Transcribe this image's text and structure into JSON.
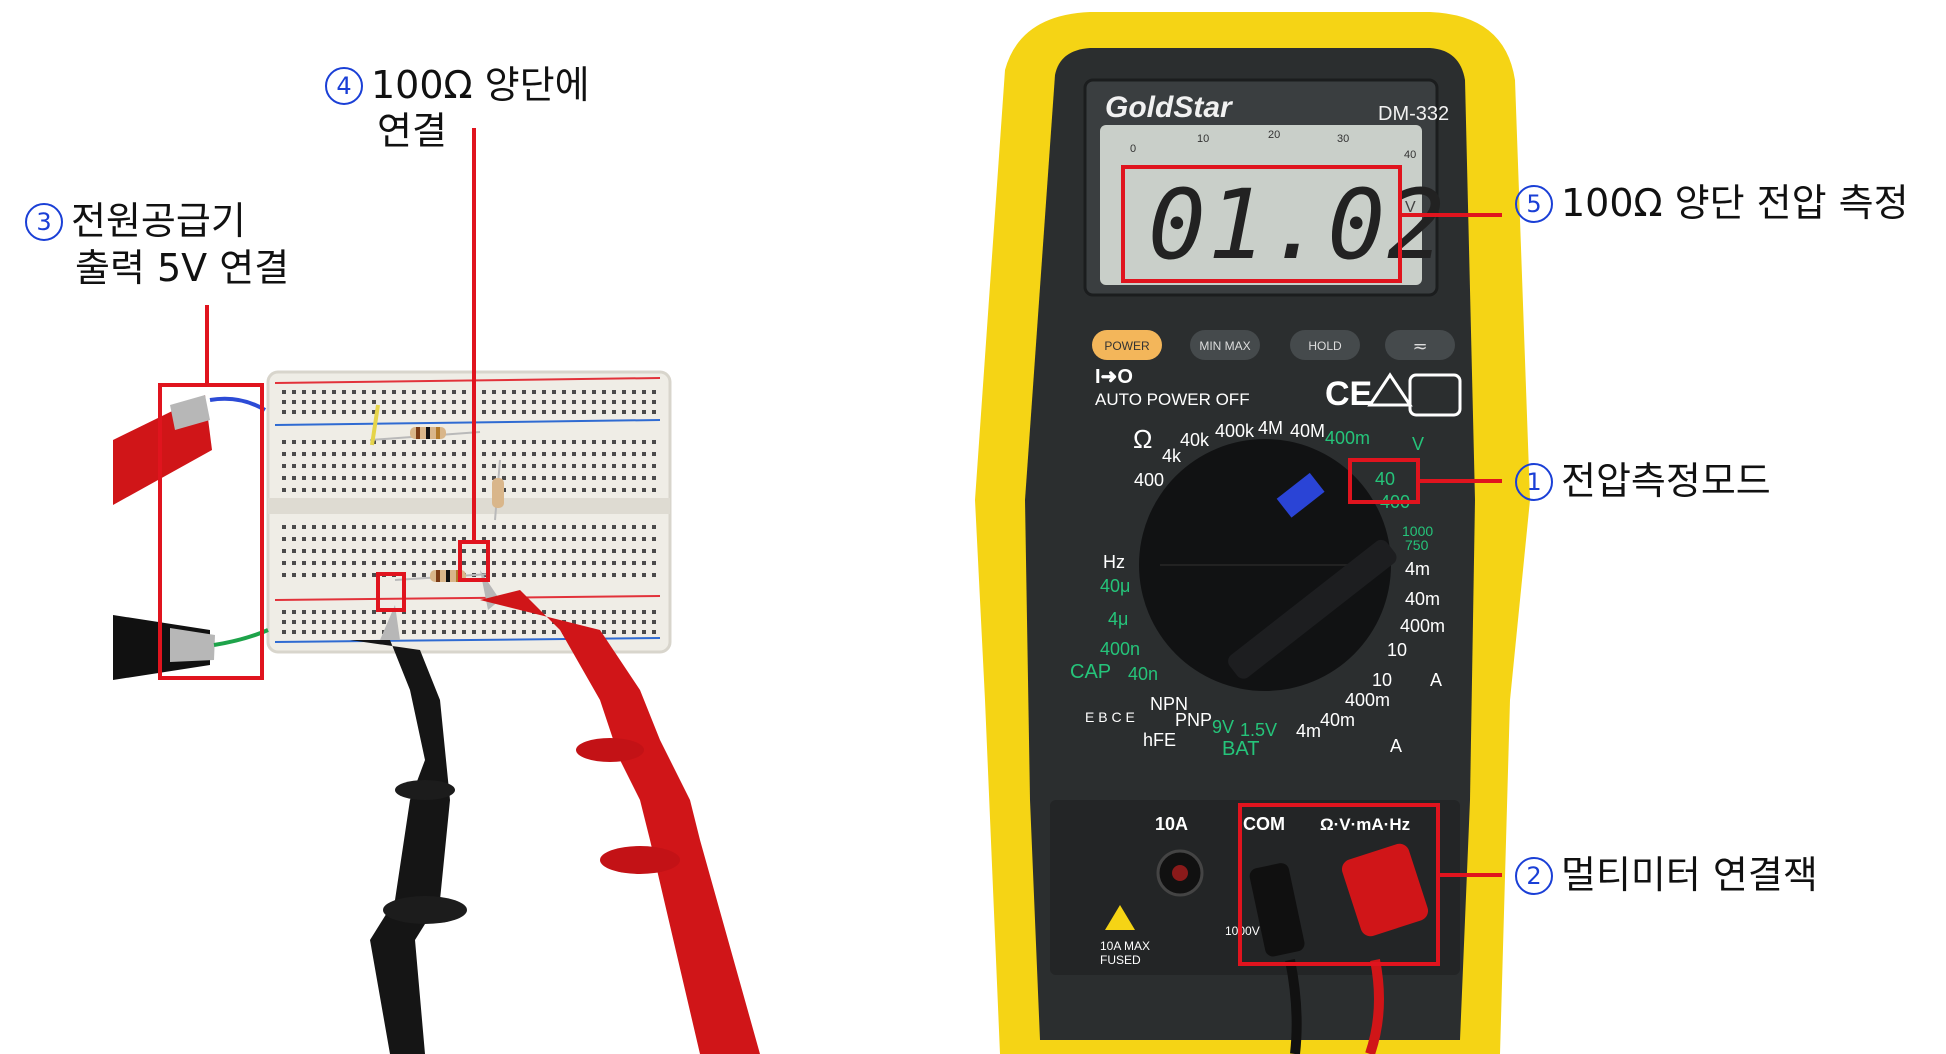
{
  "callouts": {
    "c1": {
      "num": "1",
      "text": "전압측정모드"
    },
    "c2": {
      "num": "2",
      "text": "멀티미터 연결잭"
    },
    "c3": {
      "num": "3",
      "line1": "전원공급기",
      "line2": "출력 5V 연결"
    },
    "c4": {
      "num": "4",
      "line1": "100Ω 양단에",
      "line2": "연결"
    },
    "c5": {
      "num": "5",
      "text": "100Ω 양단 전압 측정"
    }
  },
  "meter": {
    "brand": "GoldStar",
    "model": "DM-332",
    "reading": "01.02",
    "scale_marks": [
      "0",
      "10",
      "20",
      "30",
      "40"
    ],
    "buttons": {
      "power": "POWER",
      "minmax": "MIN MAX",
      "hold": "HOLD",
      "acdc": "≂"
    },
    "auto_power_off": "AUTO POWER OFF",
    "auto_power_icon": "I➜O",
    "ce_mark": "CE",
    "dial": {
      "ohm_symbol": "Ω",
      "ohm_ranges": [
        "400",
        "4k",
        "40k",
        "400k",
        "4M",
        "40M",
        "400m"
      ],
      "dc_volt_ranges": [
        "40",
        "400",
        "1000"
      ],
      "ac_volt_range": "750",
      "dc_amp_ranges": [
        "4m",
        "40m",
        "400m",
        "10"
      ],
      "ac_amp_ranges": [
        "10",
        "400m",
        "40m",
        "4m"
      ],
      "hz_label": "Hz",
      "cap_ranges": [
        "40μ",
        "4μ",
        "400n",
        "40n"
      ],
      "cap_label": "CAP",
      "transistor": [
        "NPN",
        "PNP"
      ],
      "battery_ranges": [
        "9V",
        "1.5V"
      ],
      "bat_label": "BAT",
      "hfe_label": "hFE",
      "ebce_label": "E B C E",
      "v_unit": "V",
      "a_unit": "A"
    },
    "jacks": {
      "a10": "10A",
      "com": "COM",
      "vohm": "Ω·V·mA·Hz",
      "a10max": "10A  MAX",
      "fused": "FUSED",
      "v1000": "1000V"
    }
  },
  "colors": {
    "callout_red": "#e0141e",
    "callout_blue": "#1a3fd6",
    "meter_yellow": "#f5d415",
    "meter_body": "#2b2e2f",
    "lcd": "#c9cfc9",
    "lead_red": "#d01518",
    "lead_black": "#151515"
  }
}
